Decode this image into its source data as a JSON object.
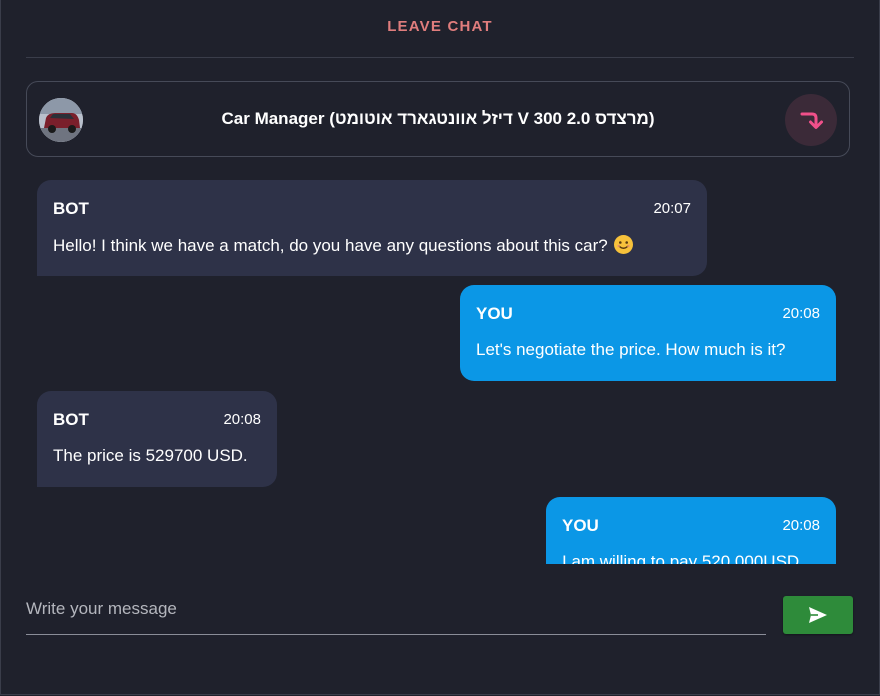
{
  "header": {
    "leave_label": "LEAVE CHAT",
    "chat_title": "Car Manager (דיזל אוונטגארד אוטומט V 300 2.0 מרצדס)"
  },
  "messages": [
    {
      "sender": "BOT",
      "time": "20:07",
      "text": "Hello! I think we have a match, do you have any questions about this car?",
      "emoji": "smiling-face"
    },
    {
      "sender": "YOU",
      "time": "20:08",
      "text": "Let's negotiate the price. How much is it?"
    },
    {
      "sender": "BOT",
      "time": "20:08",
      "text": "The price is 529700 USD."
    },
    {
      "sender": "YOU",
      "time": "20:08",
      "text": "I am willing to pay 520 000USD"
    }
  ],
  "composer": {
    "placeholder": "Write your message",
    "value": ""
  },
  "icons": {
    "avatar": "car-thumbnail",
    "redirect": "redirect-arrow-icon",
    "send": "send-icon"
  },
  "colors": {
    "background": "#1f212c",
    "bot_bubble": "#2e3248",
    "user_bubble": "#0b97e6",
    "leave_text": "#e07d7d",
    "send_button": "#2e8b3a",
    "redirect_icon": "#f0508a"
  }
}
